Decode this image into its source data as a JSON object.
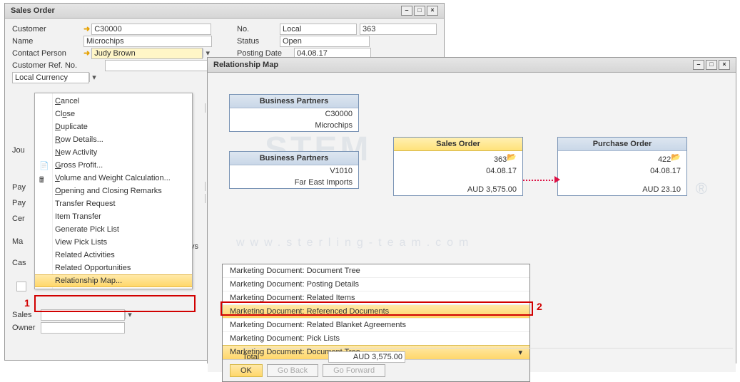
{
  "sales_window": {
    "title": "Sales Order",
    "customer_lbl": "Customer",
    "customer_val": "C30000",
    "name_lbl": "Name",
    "name_val": "Microchips",
    "contact_lbl": "Contact Person",
    "contact_val": "Judy Brown",
    "ref_lbl": "Customer Ref. No.",
    "currency_val": "Local Currency",
    "no_lbl": "No.",
    "no_type": "Local",
    "no_val": "363",
    "status_lbl": "Status",
    "status_val": "Open",
    "pdate_lbl": "Posting Date",
    "pdate_val": "04.08.17",
    "left_col": {
      "jou": "Jou",
      "pay1": "Pay",
      "pay2": "Pay",
      "cer": "Cer",
      "ma": "Ma",
      "cas": "Cas"
    },
    "days_lbl": "Days",
    "sales_lbl": "Sales",
    "owner_lbl": "Owner",
    "total_lbl": "Total",
    "total_val": "AUD 3,575.00"
  },
  "context_menu": {
    "items": [
      {
        "label": "Cancel",
        "u": 0
      },
      {
        "label": "Close",
        "u": 2
      },
      {
        "label": "Duplicate",
        "u": 0
      },
      {
        "label": "Row Details...",
        "u": 0
      },
      {
        "label": "New Activity",
        "u": 0
      },
      {
        "label": "Gross Profit...",
        "u": 0,
        "icon": "doc"
      },
      {
        "label": "Volume and Weight Calculation...",
        "u": 0,
        "icon": "calc"
      },
      {
        "label": "Opening and Closing Remarks",
        "u": 0
      },
      {
        "label": "Transfer Request"
      },
      {
        "label": "Item Transfer"
      },
      {
        "label": "Generate Pick List"
      },
      {
        "label": "View Pick Lists"
      },
      {
        "label": "Related Activities"
      },
      {
        "label": "Related Opportunities"
      },
      {
        "label": "Relationship Map...",
        "selected": true
      }
    ]
  },
  "rm_window": {
    "title": "Relationship Map"
  },
  "boxes": {
    "bp1": {
      "title": "Business Partners",
      "l1": "C30000",
      "l2": "Microchips"
    },
    "bp2": {
      "title": "Business Partners",
      "l1": "V1010",
      "l2": "Far East Imports"
    },
    "so": {
      "title": "Sales Order",
      "l1": "363",
      "l2": "04.08.17",
      "l3": "AUD 3,575.00"
    },
    "po": {
      "title": "Purchase Order",
      "l1": "422",
      "l2": "04.08.17",
      "l3": "AUD 23.10"
    }
  },
  "popup": {
    "items": [
      "Marketing Document: Document Tree",
      "Marketing Document: Posting Details",
      "Marketing Document: Related Items",
      "Marketing Document: Referenced Documents",
      "Marketing Document: Related Blanket Agreements",
      "Marketing Document: Pick Lists"
    ],
    "selected_index": 3,
    "dd_value": "Marketing Document: Document Tree",
    "ok": "OK",
    "back": "Go Back",
    "fwd": "Go Forward"
  },
  "annotations": {
    "a1": "1",
    "a2": "2"
  },
  "watermark": {
    "big": "STEM",
    "url": "www.sterling-team.com",
    "r": "®"
  }
}
